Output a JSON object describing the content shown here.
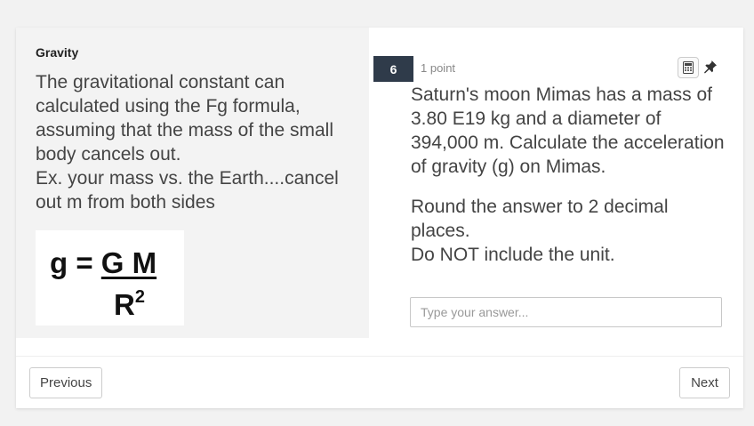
{
  "passage": {
    "title": "Gravity",
    "text": "The gravitational constant can calculated using the Fg formula, assuming that the mass of the small body cancels out.\nEx.  your mass vs. the Earth....cancel out m from both sides",
    "formula": {
      "lhs": "g = ",
      "numerator": "G M",
      "denominator": "R",
      "exponent": "2"
    }
  },
  "question": {
    "number": "6",
    "points": "1 point",
    "text_1": "Saturn's moon Mimas has a mass of 3.80 E19 kg and a diameter of 394,000 m.    Calculate the acceleration of gravity (g) on Mimas.",
    "text_2": "Round the answer to 2 decimal places.\nDo NOT include the unit.",
    "answer_placeholder": "Type your answer...",
    "answer_value": ""
  },
  "toolbar": {
    "calculator_icon": "calculator-icon",
    "pin_icon": "pin-icon"
  },
  "navigation": {
    "previous_label": "Previous",
    "next_label": "Next"
  },
  "colors": {
    "question_badge": "#2f3b4a",
    "left_panel_bg": "#f3f3f3",
    "page_bg": "#f2f2f2"
  }
}
